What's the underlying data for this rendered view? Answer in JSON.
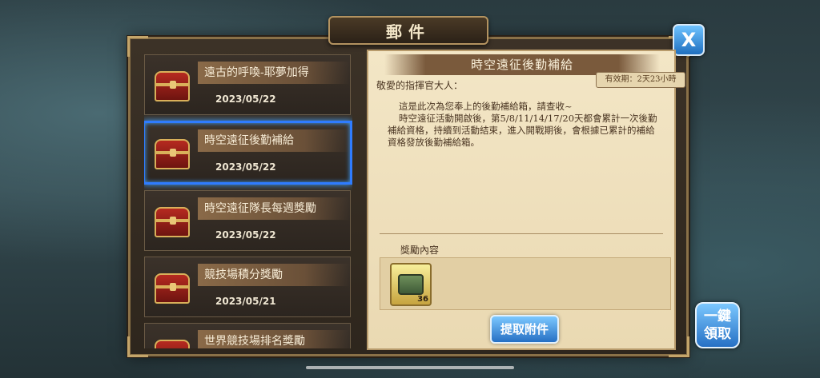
{
  "window": {
    "title": "郵件",
    "close_label": "X"
  },
  "mail_list": [
    {
      "title": "遠古的呼喚-耶夢加得",
      "date": "2023/05/22",
      "selected": false
    },
    {
      "title": "時空遠征後勤補給",
      "date": "2023/05/22",
      "selected": true
    },
    {
      "title": "時空遠征隊長每週獎勵",
      "date": "2023/05/22",
      "selected": false
    },
    {
      "title": "競技場積分獎勵",
      "date": "2023/05/21",
      "selected": false
    },
    {
      "title": "世界競技場排名獎勵",
      "date": "",
      "selected": false
    }
  ],
  "detail": {
    "title": "時空遠征後勤補給",
    "expiry": "有效期：2天23小時",
    "greeting": "敬愛的指揮官大人：",
    "body": [
      "這是此次為您奉上的後勤補給箱，請查收~",
      "時空遠征活動開啟後，第5/8/11/14/17/20天都會累計一次後勤補給資格，持續到活動結束，進入開戰期後，會根據已累計的補給資格發放後勤補給箱。"
    ],
    "reward_label": "獎勵內容",
    "rewards": [
      {
        "icon": "supply-chest-icon",
        "count": "36"
      }
    ],
    "claim_label": "提取附件"
  },
  "claim_all_label": "一鍵領取",
  "colors": {
    "accent_blue": "#2670c4",
    "selection_glow": "#3fa0ff",
    "parchment": "#f3e6c6"
  }
}
